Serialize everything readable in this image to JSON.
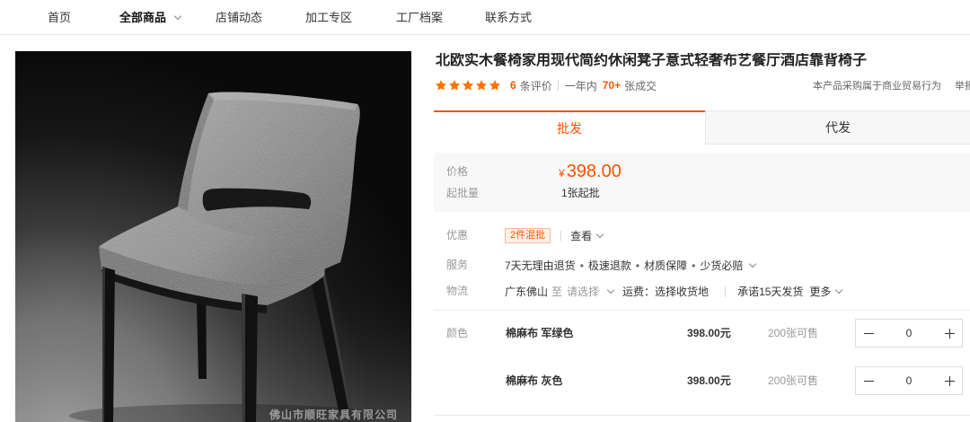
{
  "nav": {
    "items": [
      {
        "label": "首页"
      },
      {
        "label": "全部商品"
      },
      {
        "label": "店铺动态"
      },
      {
        "label": "加工专区"
      },
      {
        "label": "工厂档案"
      },
      {
        "label": "联系方式"
      }
    ],
    "active_index": 1
  },
  "gallery": {
    "watermark": "佛山市顺旺家具有限公司"
  },
  "product": {
    "title": "北欧实木餐椅家用现代简约休闲凳子意式轻奢布艺餐厅酒店靠背椅子",
    "rating": {
      "stars": 5,
      "review_count": "6",
      "review_label": "条评价",
      "period_label": "一年内",
      "sold_count": "70+",
      "sold_label": "张成交"
    },
    "trade_notice": "本产品采购属于商业贸易行为",
    "report_label": "举报"
  },
  "tabs": [
    {
      "label": "批发",
      "active": true
    },
    {
      "label": "代发",
      "active": false
    }
  ],
  "pricing": {
    "price_label": "价格",
    "currency": "¥",
    "price": "398.00",
    "moq_label": "起批量",
    "moq": "1张起批"
  },
  "attributes": {
    "promo": {
      "label": "优惠",
      "badge": "2件混批",
      "link": "查看"
    },
    "service": {
      "label": "服务",
      "items": [
        "7天无理由退货",
        "极速退款",
        "材质保障",
        "少货必赔"
      ],
      "separator": "•"
    },
    "logistics": {
      "label": "物流",
      "origin": "广东佛山",
      "to": "至",
      "destination_placeholder": "请选择",
      "shipping_fee": "运费：选择收货地",
      "promise": "承诺15天发货",
      "more": "更多"
    }
  },
  "colors": {
    "label": "颜色",
    "options": [
      {
        "name": "棉麻布 军绿色",
        "price": "398.00元",
        "stock": "200张可售",
        "quantity": "0"
      },
      {
        "name": "棉麻布 灰色",
        "price": "398.00元",
        "stock": "200张可售",
        "quantity": "0"
      }
    ]
  },
  "icons": [
    "chevron-down-icon",
    "star-icon",
    "minus-icon",
    "plus-icon"
  ],
  "theme": {
    "accent": "#ff5000",
    "star": "#ff7300",
    "label_gray": "#999999",
    "text": "#333333"
  }
}
